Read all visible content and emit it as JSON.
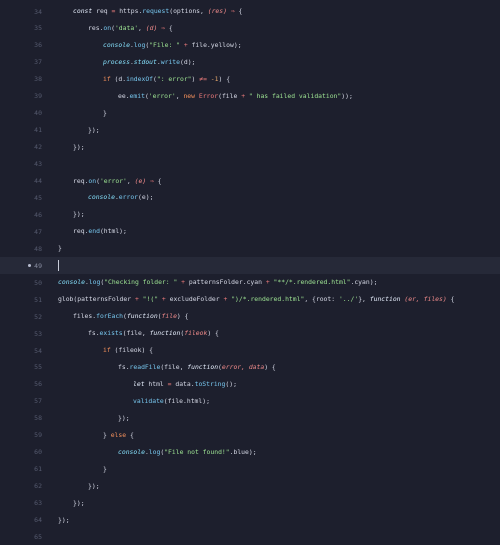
{
  "editor": {
    "cursor_line": 49,
    "lines": [
      {
        "num": "34",
        "indent": 1,
        "segments": [
          {
            "t": "const",
            "c": "kw it"
          },
          {
            "t": " req ",
            "c": "pr"
          },
          {
            "t": "=",
            "c": "op"
          },
          {
            "t": " https.",
            "c": "pr"
          },
          {
            "t": "request",
            "c": "fn"
          },
          {
            "t": "(options, ",
            "c": "pr"
          },
          {
            "t": "(res)",
            "c": "pl"
          },
          {
            "t": " ⇒ ",
            "c": "op"
          },
          {
            "t": "{",
            "c": "pr"
          }
        ]
      },
      {
        "num": "35",
        "indent": 2,
        "segments": [
          {
            "t": "res.",
            "c": "pr"
          },
          {
            "t": "on",
            "c": "fn"
          },
          {
            "t": "(",
            "c": "pr"
          },
          {
            "t": "'data'",
            "c": "str"
          },
          {
            "t": ", ",
            "c": "pr"
          },
          {
            "t": "(d)",
            "c": "pl"
          },
          {
            "t": " ⇒ ",
            "c": "op"
          },
          {
            "t": "{",
            "c": "pr"
          }
        ]
      },
      {
        "num": "36",
        "indent": 3,
        "segments": [
          {
            "t": "console",
            "c": "ob"
          },
          {
            "t": ".",
            "c": "pr"
          },
          {
            "t": "log",
            "c": "fn"
          },
          {
            "t": "(",
            "c": "pr"
          },
          {
            "t": "\"File: \"",
            "c": "str"
          },
          {
            "t": " + ",
            "c": "op"
          },
          {
            "t": "file.yellow);",
            "c": "pr"
          }
        ]
      },
      {
        "num": "37",
        "indent": 3,
        "segments": [
          {
            "t": "process",
            "c": "ob"
          },
          {
            "t": ".",
            "c": "pr"
          },
          {
            "t": "stdout",
            "c": "ob"
          },
          {
            "t": ".",
            "c": "pr"
          },
          {
            "t": "write",
            "c": "fn"
          },
          {
            "t": "(d);",
            "c": "pr"
          }
        ]
      },
      {
        "num": "38",
        "indent": 3,
        "segments": [
          {
            "t": "if",
            "c": "kw2"
          },
          {
            "t": " (d.",
            "c": "pr"
          },
          {
            "t": "indexOf",
            "c": "fn"
          },
          {
            "t": "(",
            "c": "pr"
          },
          {
            "t": "\": error\"",
            "c": "str"
          },
          {
            "t": ") ",
            "c": "pr"
          },
          {
            "t": "≠=",
            "c": "op"
          },
          {
            "t": " ",
            "c": "pr"
          },
          {
            "t": "-1",
            "c": "nm"
          },
          {
            "t": ") {",
            "c": "pr"
          }
        ]
      },
      {
        "num": "39",
        "indent": 4,
        "segments": [
          {
            "t": "ee.",
            "c": "pr"
          },
          {
            "t": "emit",
            "c": "fn"
          },
          {
            "t": "(",
            "c": "pr"
          },
          {
            "t": "'error'",
            "c": "str"
          },
          {
            "t": ", ",
            "c": "pr"
          },
          {
            "t": "new",
            "c": "kw2"
          },
          {
            "t": " ",
            "c": "pr"
          },
          {
            "t": "Error",
            "c": "op"
          },
          {
            "t": "(file ",
            "c": "pr"
          },
          {
            "t": "+",
            "c": "op"
          },
          {
            "t": " ",
            "c": "pr"
          },
          {
            "t": "\" has failed validation\"",
            "c": "str"
          },
          {
            "t": "));",
            "c": "pr"
          }
        ]
      },
      {
        "num": "40",
        "indent": 3,
        "segments": [
          {
            "t": "}",
            "c": "pr"
          }
        ]
      },
      {
        "num": "41",
        "indent": 2,
        "segments": [
          {
            "t": "});",
            "c": "pr"
          }
        ]
      },
      {
        "num": "42",
        "indent": 1,
        "segments": [
          {
            "t": "});",
            "c": "pr"
          }
        ]
      },
      {
        "num": "43",
        "indent": 0,
        "segments": []
      },
      {
        "num": "44",
        "indent": 1,
        "segments": [
          {
            "t": "req.",
            "c": "pr"
          },
          {
            "t": "on",
            "c": "fn"
          },
          {
            "t": "(",
            "c": "pr"
          },
          {
            "t": "'error'",
            "c": "str"
          },
          {
            "t": ", ",
            "c": "pr"
          },
          {
            "t": "(e)",
            "c": "pl"
          },
          {
            "t": " ⇒ ",
            "c": "op"
          },
          {
            "t": "{",
            "c": "pr"
          }
        ]
      },
      {
        "num": "45",
        "indent": 2,
        "segments": [
          {
            "t": "console",
            "c": "ob"
          },
          {
            "t": ".",
            "c": "pr"
          },
          {
            "t": "error",
            "c": "fn"
          },
          {
            "t": "(e);",
            "c": "pr"
          }
        ]
      },
      {
        "num": "46",
        "indent": 1,
        "segments": [
          {
            "t": "});",
            "c": "pr"
          }
        ]
      },
      {
        "num": "47",
        "indent": 1,
        "segments": [
          {
            "t": "req.",
            "c": "pr"
          },
          {
            "t": "end",
            "c": "fn"
          },
          {
            "t": "(html);",
            "c": "pr"
          }
        ]
      },
      {
        "num": "48",
        "indent": 0,
        "segments": [
          {
            "t": "}",
            "c": "pr"
          }
        ]
      },
      {
        "num": "49",
        "indent": 0,
        "segments": []
      },
      {
        "num": "50",
        "indent": 0,
        "segments": [
          {
            "t": "console",
            "c": "ob"
          },
          {
            "t": ".",
            "c": "pr"
          },
          {
            "t": "log",
            "c": "fn"
          },
          {
            "t": "(",
            "c": "pr"
          },
          {
            "t": "\"Checking folder: \"",
            "c": "str"
          },
          {
            "t": " + ",
            "c": "op"
          },
          {
            "t": "patternsFolder.cyan ",
            "c": "pr"
          },
          {
            "t": "+",
            "c": "op"
          },
          {
            "t": " ",
            "c": "pr"
          },
          {
            "t": "\"**/*.rendered.html\"",
            "c": "str"
          },
          {
            "t": ".cyan);",
            "c": "pr"
          }
        ]
      },
      {
        "num": "51",
        "indent": 0,
        "segments": [
          {
            "t": "glob",
            "c": "pr"
          },
          {
            "t": "(patternsFolder ",
            "c": "pr"
          },
          {
            "t": "+",
            "c": "op"
          },
          {
            "t": " ",
            "c": "pr"
          },
          {
            "t": "\"!(\"",
            "c": "str"
          },
          {
            "t": " + ",
            "c": "op"
          },
          {
            "t": "excludeFolder ",
            "c": "pr"
          },
          {
            "t": "+",
            "c": "op"
          },
          {
            "t": " ",
            "c": "pr"
          },
          {
            "t": "\")/*.rendered.html\"",
            "c": "str"
          },
          {
            "t": ", {root: ",
            "c": "pr"
          },
          {
            "t": "'../'",
            "c": "str"
          },
          {
            "t": "}, ",
            "c": "pr"
          },
          {
            "t": "function",
            "c": "kw it"
          },
          {
            "t": " ",
            "c": "pr"
          },
          {
            "t": "(er, files)",
            "c": "pl"
          },
          {
            "t": " {",
            "c": "pr"
          }
        ]
      },
      {
        "num": "52",
        "indent": 1,
        "segments": [
          {
            "t": "files.",
            "c": "pr"
          },
          {
            "t": "forEach",
            "c": "fn"
          },
          {
            "t": "(",
            "c": "pr"
          },
          {
            "t": "function",
            "c": "kw it"
          },
          {
            "t": "(",
            "c": "pr"
          },
          {
            "t": "file",
            "c": "pl"
          },
          {
            "t": ") {",
            "c": "pr"
          }
        ]
      },
      {
        "num": "53",
        "indent": 2,
        "segments": [
          {
            "t": "fs.",
            "c": "pr"
          },
          {
            "t": "exists",
            "c": "fn"
          },
          {
            "t": "(file, ",
            "c": "pr"
          },
          {
            "t": "function",
            "c": "kw it"
          },
          {
            "t": "(",
            "c": "pr"
          },
          {
            "t": "fileok",
            "c": "pl"
          },
          {
            "t": ") {",
            "c": "pr"
          }
        ]
      },
      {
        "num": "54",
        "indent": 3,
        "segments": [
          {
            "t": "if",
            "c": "kw2"
          },
          {
            "t": " (fileok) {",
            "c": "pr"
          }
        ]
      },
      {
        "num": "55",
        "indent": 4,
        "segments": [
          {
            "t": "fs.",
            "c": "pr"
          },
          {
            "t": "readFile",
            "c": "fn"
          },
          {
            "t": "(file, ",
            "c": "pr"
          },
          {
            "t": "function",
            "c": "kw it"
          },
          {
            "t": "(",
            "c": "pr"
          },
          {
            "t": "error, data",
            "c": "pl"
          },
          {
            "t": ") {",
            "c": "pr"
          }
        ]
      },
      {
        "num": "56",
        "indent": 5,
        "segments": [
          {
            "t": "let",
            "c": "kw it"
          },
          {
            "t": " html ",
            "c": "pr"
          },
          {
            "t": "=",
            "c": "op"
          },
          {
            "t": " data.",
            "c": "pr"
          },
          {
            "t": "toString",
            "c": "fn"
          },
          {
            "t": "();",
            "c": "pr"
          }
        ]
      },
      {
        "num": "57",
        "indent": 5,
        "segments": [
          {
            "t": "validate",
            "c": "fn"
          },
          {
            "t": "(file.html);",
            "c": "pr"
          }
        ]
      },
      {
        "num": "58",
        "indent": 4,
        "segments": [
          {
            "t": "});",
            "c": "pr"
          }
        ]
      },
      {
        "num": "59",
        "indent": 3,
        "segments": [
          {
            "t": "} ",
            "c": "pr"
          },
          {
            "t": "else",
            "c": "kw2"
          },
          {
            "t": " {",
            "c": "pr"
          }
        ]
      },
      {
        "num": "60",
        "indent": 4,
        "segments": [
          {
            "t": "console",
            "c": "ob"
          },
          {
            "t": ".",
            "c": "pr"
          },
          {
            "t": "log",
            "c": "fn"
          },
          {
            "t": "(",
            "c": "pr"
          },
          {
            "t": "\"File not found!\"",
            "c": "str"
          },
          {
            "t": ".blue);",
            "c": "pr"
          }
        ]
      },
      {
        "num": "61",
        "indent": 3,
        "segments": [
          {
            "t": "}",
            "c": "pr"
          }
        ]
      },
      {
        "num": "62",
        "indent": 2,
        "segments": [
          {
            "t": "});",
            "c": "pr"
          }
        ]
      },
      {
        "num": "63",
        "indent": 1,
        "segments": [
          {
            "t": "});",
            "c": "pr"
          }
        ]
      },
      {
        "num": "64",
        "indent": 0,
        "segments": [
          {
            "t": "});",
            "c": "pr"
          }
        ]
      },
      {
        "num": "65",
        "indent": 0,
        "segments": []
      }
    ]
  },
  "colors": {
    "background": "#1d1f2d",
    "current_line": "#262938",
    "string": "#9ee493",
    "function": "#78c8f0",
    "operator": "#f07c7c",
    "keyword": "#f5915c"
  }
}
